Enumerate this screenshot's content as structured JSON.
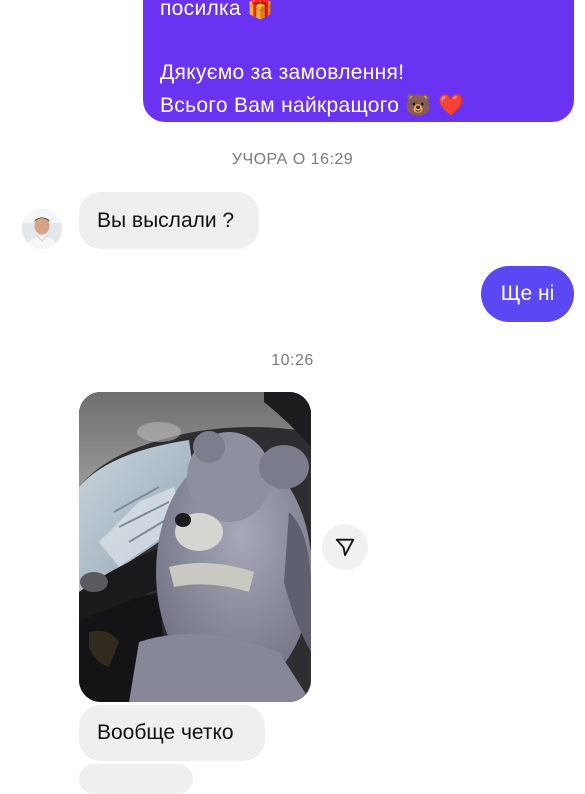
{
  "thread": {
    "outgoing_top": {
      "line1": "посилка",
      "line1_emoji": "🎁",
      "line2": "Дякуємо за замовлення!",
      "line3": "Всього Вам найкращого",
      "line3_emoji_bear": "🐻",
      "line3_emoji_heart": "❤️"
    },
    "timestamp_1": "УЧОРА О 16:29",
    "incoming_1": "Вы выслали ?",
    "outgoing_2": "Ще ні",
    "timestamp_2": "10:26",
    "incoming_2": "Вообще четко"
  },
  "icons": {
    "avatar": "avatar",
    "share": "share-icon",
    "photo": "teddy-bear-in-car-photo"
  },
  "colors": {
    "outgoing_bubble_top": "#6a33f2",
    "outgoing_bubble": "#5b48f4",
    "incoming_bubble": "#efefef",
    "timestamp_text": "#7a7a7a"
  }
}
